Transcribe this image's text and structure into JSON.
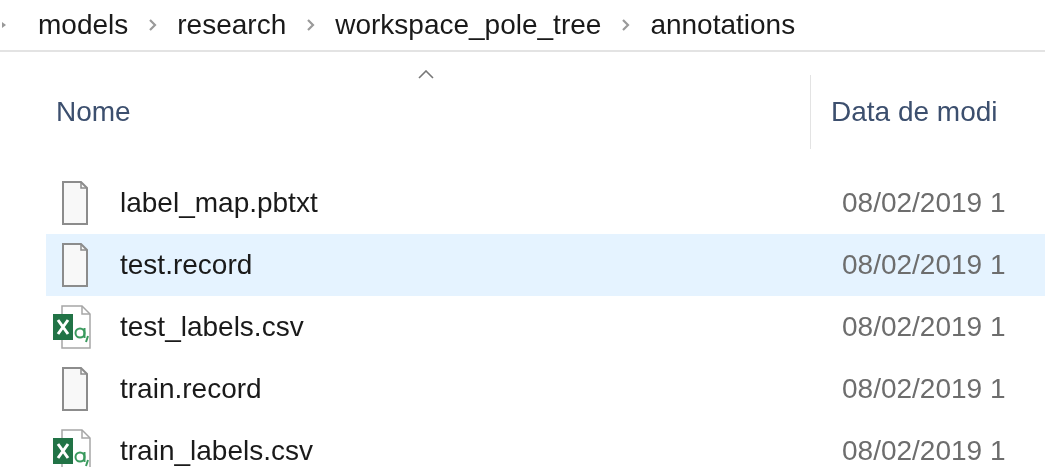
{
  "breadcrumb": [
    "models",
    "research",
    "workspace_pole_tree",
    "annotations"
  ],
  "columns": [
    "Nome",
    "Data de modi"
  ],
  "files": [
    {
      "name": "label_map.pbtxt",
      "date": "08/02/2019 1",
      "kind": "file",
      "selected": false
    },
    {
      "name": "test.record",
      "date": "08/02/2019 1",
      "kind": "file",
      "selected": true
    },
    {
      "name": "test_labels.csv",
      "date": "08/02/2019 1",
      "kind": "csv",
      "selected": false
    },
    {
      "name": "train.record",
      "date": "08/02/2019 1",
      "kind": "file",
      "selected": false
    },
    {
      "name": "train_labels.csv",
      "date": "08/02/2019 1",
      "kind": "csv",
      "selected": false
    }
  ]
}
